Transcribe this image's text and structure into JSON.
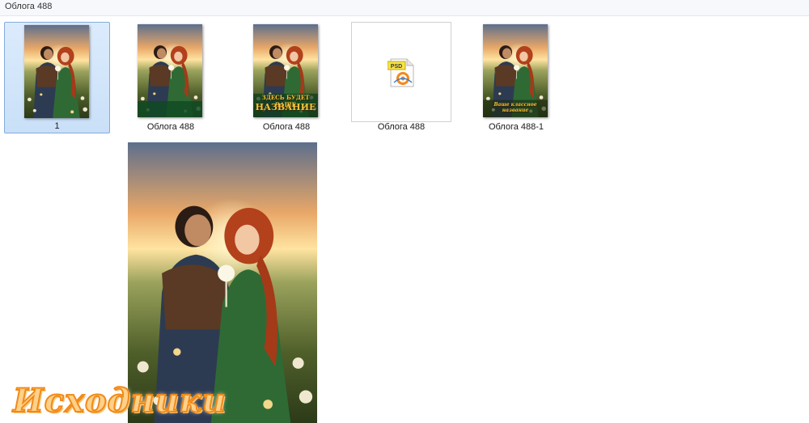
{
  "window": {
    "title": "Облога 488"
  },
  "files": [
    {
      "caption": "1",
      "type": "jpg",
      "selected": true
    },
    {
      "caption": "Облога  488",
      "type": "jpg",
      "selected": false
    },
    {
      "caption": "Облога 488",
      "type": "jpg",
      "selected": false
    },
    {
      "caption": "Облога 488",
      "type": "psd",
      "selected": false
    },
    {
      "caption": "Облога 488-1",
      "type": "jpg",
      "selected": false
    }
  ],
  "thumb3_text": {
    "line1": "ЗДЕСЬ БУДЕТ ВАШЕ",
    "line2": "НАЗВАНИЕ"
  },
  "thumb5_text": {
    "line1": "Ваше классное название"
  },
  "psd_badge": "PSD",
  "watermark": "Исходники",
  "colors": {
    "selection": "#cce4f7",
    "selection_border": "#84acdd",
    "watermark": "#f08a18"
  },
  "icons": [
    "psd-file-icon"
  ]
}
